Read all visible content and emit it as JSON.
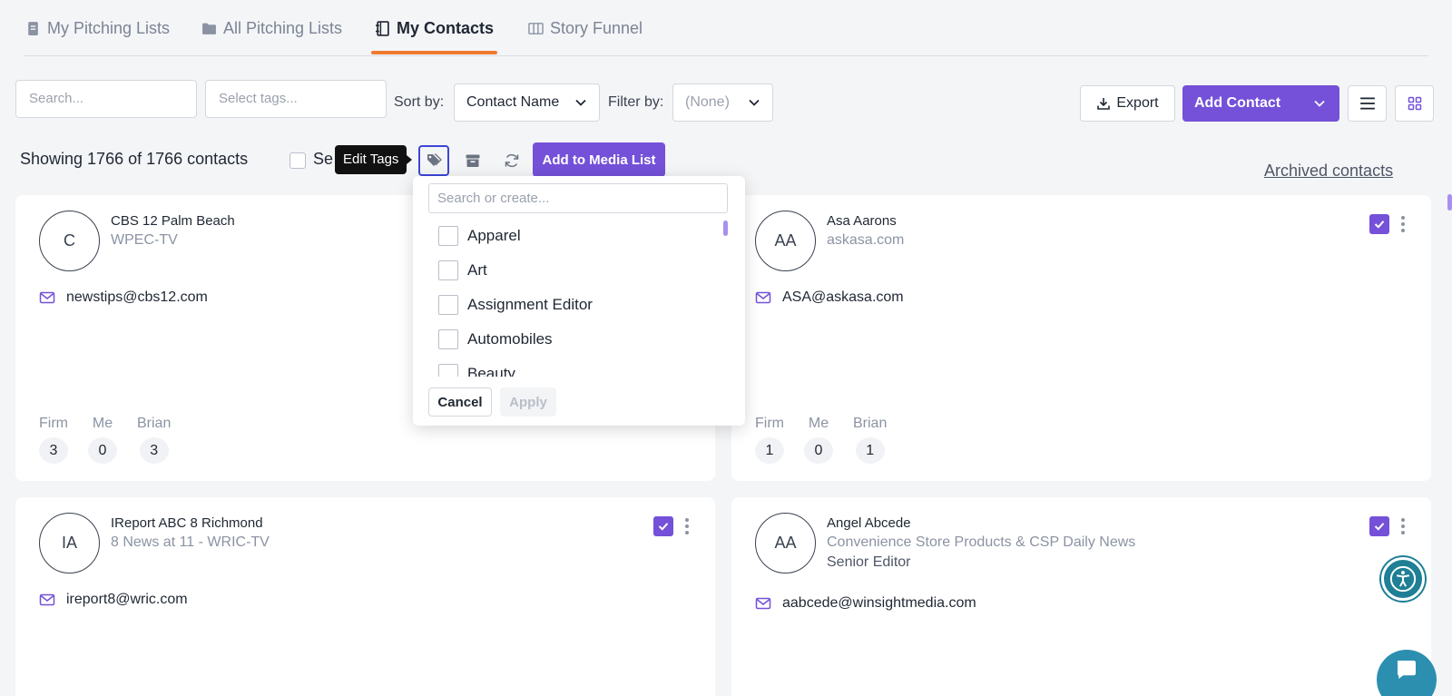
{
  "tabs": [
    {
      "label": "My Pitching Lists",
      "icon": "document-icon"
    },
    {
      "label": "All Pitching Lists",
      "icon": "folder-icon"
    },
    {
      "label": "My Contacts",
      "icon": "notebook-icon",
      "active": true
    },
    {
      "label": "Story Funnel",
      "icon": "columns-icon"
    }
  ],
  "toolbar": {
    "search_placeholder": "Search...",
    "tags_placeholder": "Select tags...",
    "sort_label": "Sort by:",
    "sort_value": "Contact Name",
    "filter_label": "Filter by:",
    "filter_value": "(None)",
    "export_label": "Export",
    "add_contact_label": "Add Contact"
  },
  "bulk_bar": {
    "showing_text": "Showing 1766 of 1766 contacts",
    "select_all_partial": "Se",
    "tooltip": "Edit Tags",
    "add_to_media_list": "Add to Media List",
    "archived_link": "Archived contacts"
  },
  "tag_dropdown": {
    "search_placeholder": "Search or create...",
    "items": [
      "Apparel",
      "Art",
      "Assignment Editor",
      "Automobiles",
      "Beauty"
    ],
    "cancel_label": "Cancel",
    "apply_label": "Apply"
  },
  "stat_labels": [
    "Firm",
    "Me",
    "Brian"
  ],
  "contacts": [
    {
      "initials": "C",
      "name": "CBS 12 Palm Beach",
      "outlet": "WPEC-TV",
      "title": "",
      "email": "newstips@cbs12.com",
      "stats": [
        "3",
        "0",
        "3"
      ],
      "checked": false
    },
    {
      "initials": "AA",
      "name": "Asa Aarons",
      "outlet": "askasa.com",
      "title": "",
      "email": "ASA@askasa.com",
      "stats": [
        "1",
        "0",
        "1"
      ],
      "checked": true
    },
    {
      "initials": "IA",
      "name": "IReport ABC 8 Richmond",
      "outlet": "8 News at 11 - WRIC-TV",
      "title": "",
      "email": "ireport8@wric.com",
      "checked": true
    },
    {
      "initials": "AA",
      "name": "Angel Abcede",
      "outlet": "Convenience Store Products & CSP Daily News",
      "title": "Senior Editor",
      "email": "aabcede@winsightmedia.com",
      "checked": true
    }
  ],
  "colors": {
    "accent": "#7451d8",
    "tab_underline": "#f07a2e"
  }
}
